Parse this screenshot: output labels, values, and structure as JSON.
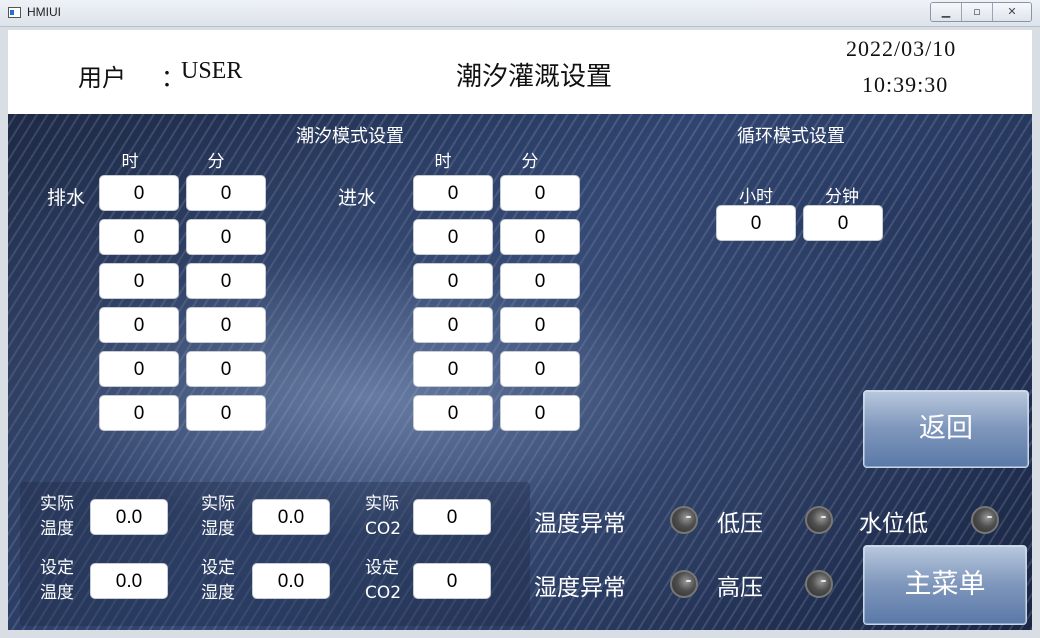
{
  "window": {
    "title": "HMIUI"
  },
  "header": {
    "user_label": "用户",
    "user_colon": "：",
    "user_name": "USER",
    "page_title": "潮汐灌溉设置",
    "date": "2022/03/10",
    "time": "10:39:30"
  },
  "tide": {
    "title": "潮汐模式设置",
    "col_hour": "时",
    "col_min": "分",
    "drain_label": "排水",
    "inlet_label": "进水",
    "drain": [
      [
        "0",
        "0"
      ],
      [
        "0",
        "0"
      ],
      [
        "0",
        "0"
      ],
      [
        "0",
        "0"
      ],
      [
        "0",
        "0"
      ],
      [
        "0",
        "0"
      ]
    ],
    "inlet": [
      [
        "0",
        "0"
      ],
      [
        "0",
        "0"
      ],
      [
        "0",
        "0"
      ],
      [
        "0",
        "0"
      ],
      [
        "0",
        "0"
      ],
      [
        "0",
        "0"
      ]
    ]
  },
  "cycle": {
    "title": "循环模式设置",
    "hour_label": "小时",
    "min_label": "分钟",
    "hour": "0",
    "min": "0"
  },
  "buttons": {
    "back": "返回",
    "main_menu": "主菜单"
  },
  "readings": {
    "actual_temp_label": "实际\n温度",
    "actual_temp": "0.0",
    "actual_hum_label": "实际\n湿度",
    "actual_hum": "0.0",
    "actual_co2_label": "实际\nCO2",
    "actual_co2": "0",
    "set_temp_label": "设定\n温度",
    "set_temp": "0.0",
    "set_hum_label": "设定\n湿度",
    "set_hum": "0.0",
    "set_co2_label": "设定\nCO2",
    "set_co2": "0"
  },
  "alarms": {
    "temp_abnormal": "温度异常",
    "hum_abnormal": "湿度异常",
    "low_pressure": "低压",
    "high_pressure": "高压",
    "low_water": "水位低"
  }
}
